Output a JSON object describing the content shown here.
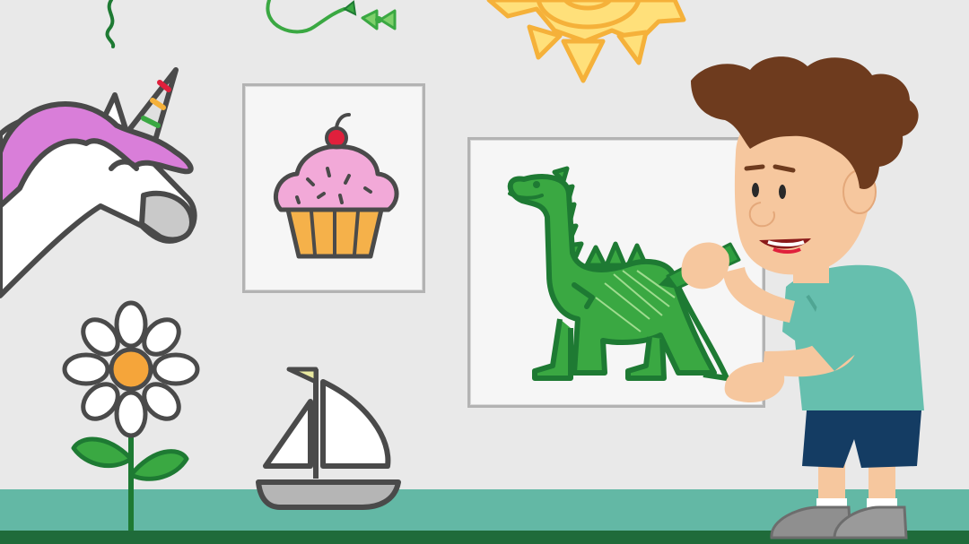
{
  "scene": {
    "title": "",
    "colors": {
      "wall": "#e9e9e9",
      "floor": "#63b8a5",
      "floor_trim": "#1f6b3a",
      "frame_border": "#b3b3b3",
      "frame_fill": "#f6f6f6",
      "outline": "#4a4a4a",
      "dino_green": "#3aa842",
      "dino_dark": "#1e7a33",
      "sun_yellow": "#ffe07a",
      "sun_orange": "#f5b13a",
      "cupcake_frosting": "#f2a9d8",
      "cupcake_cherry": "#e0203c",
      "cupcake_wrapper": "#f5b14a",
      "unicorn_mane": "#d97ed9",
      "flower_center": "#f5a53a",
      "leaf_green": "#3aa842",
      "boy_hair": "#6e3b1e",
      "boy_skin": "#f6c79e",
      "boy_shirt": "#66bfae",
      "boy_shorts": "#143c63",
      "boy_shoes": "#8f8f8f",
      "crayon_green": "#2f9e3f"
    },
    "icons": [
      "sun-icon",
      "streamer-icon",
      "bow-string-icon",
      "unicorn-icon",
      "cupcake-icon",
      "dinosaur-icon",
      "flower-icon",
      "sailboat-icon",
      "boy-illustration",
      "crayon-icon"
    ]
  }
}
